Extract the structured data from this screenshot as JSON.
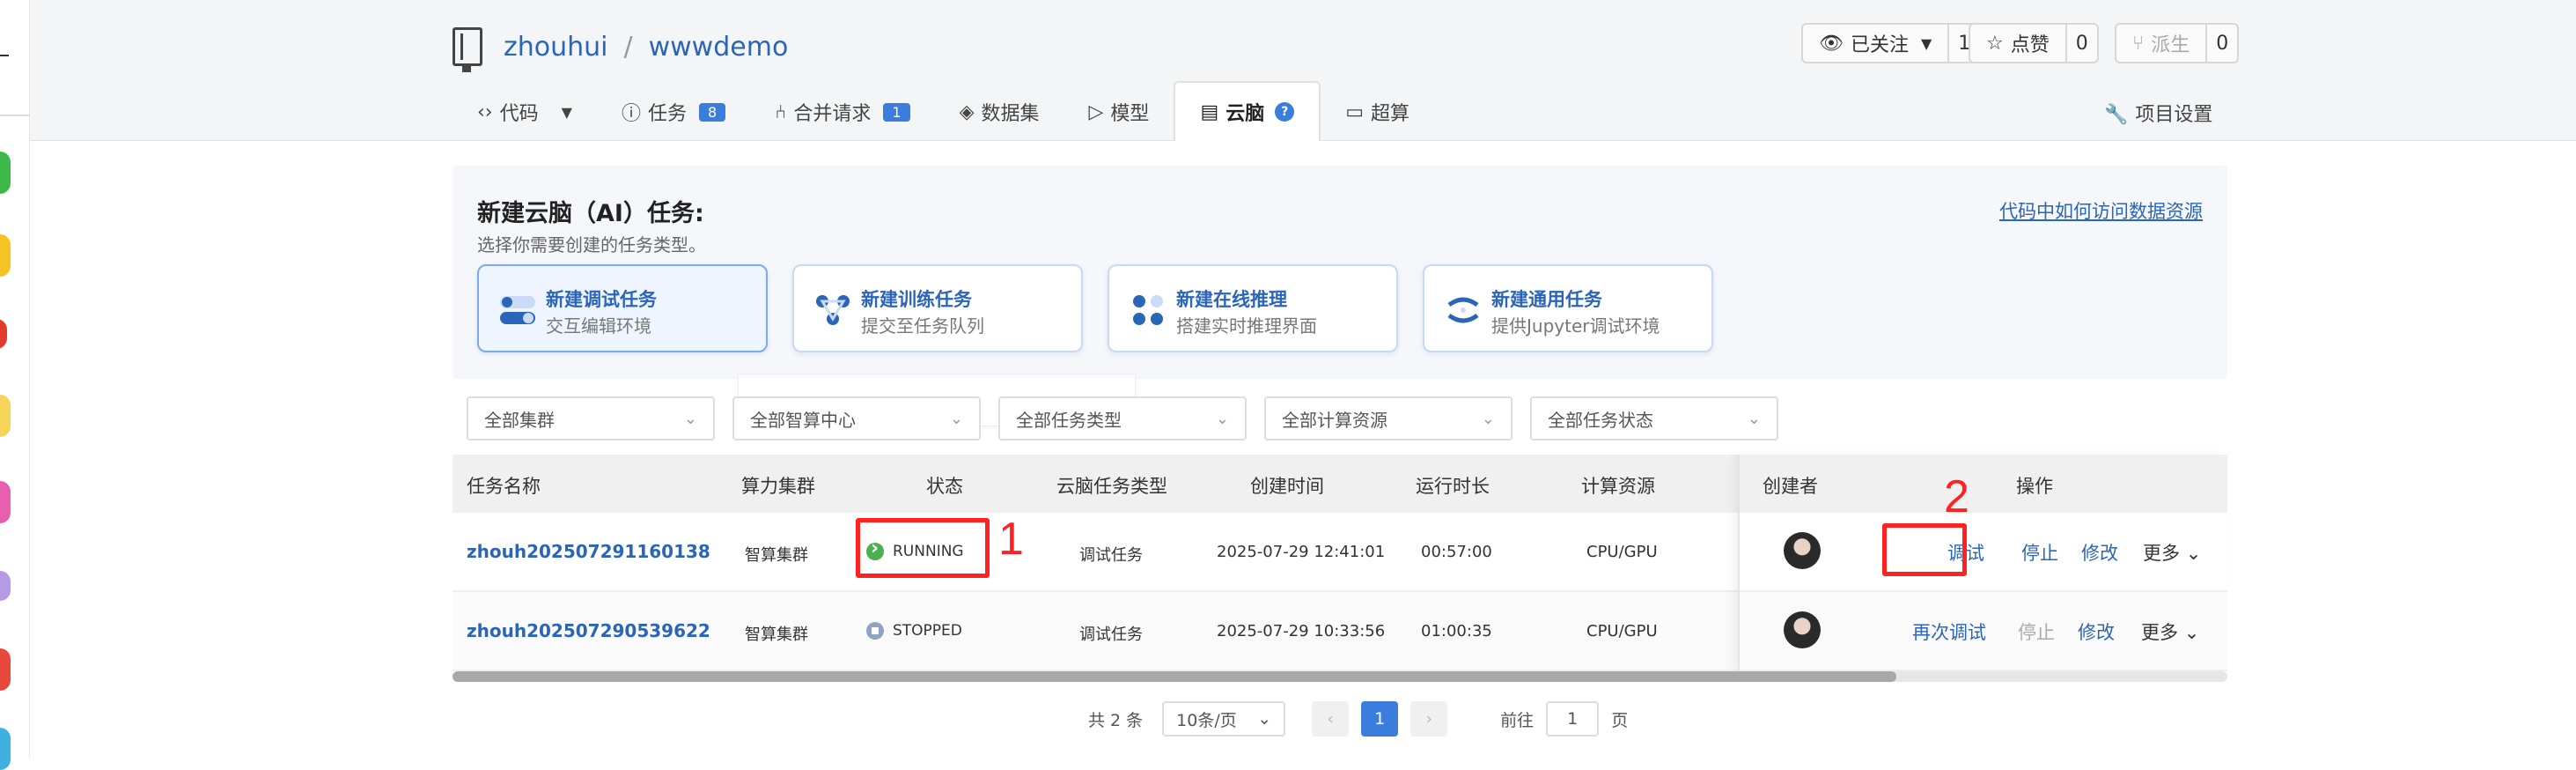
{
  "repo": {
    "owner": "zhouhui",
    "sep": "/",
    "name": "wwwdemo"
  },
  "header_buttons": {
    "watch": {
      "label": "已关注",
      "count": "1"
    },
    "star": {
      "label": "点赞",
      "count": "0"
    },
    "fork": {
      "label": "派生",
      "count": "0"
    }
  },
  "tabs": [
    {
      "label": "代码"
    },
    {
      "label": "任务",
      "badge": "8"
    },
    {
      "label": "合并请求",
      "badge": "1"
    },
    {
      "label": "数据集"
    },
    {
      "label": "模型"
    },
    {
      "label": "云脑",
      "qm": "?"
    },
    {
      "label": "超算"
    }
  ],
  "settings_label": "项目设置",
  "new_task": {
    "title": "新建云脑（AI）任务:",
    "subtitle": "选择你需要创建的任务类型。",
    "help_link": "代码中如何访问数据资源",
    "cards": [
      {
        "title": "新建调试任务",
        "desc": "交互编辑环境"
      },
      {
        "title": "新建训练任务",
        "desc": "提交至任务队列"
      },
      {
        "title": "新建在线推理",
        "desc": "搭建实时推理界面"
      },
      {
        "title": "新建通用任务",
        "desc": "提供Jupyter调试环境"
      }
    ]
  },
  "filters": [
    "全部集群",
    "全部智算中心",
    "全部任务类型",
    "全部计算资源",
    "全部任务状态"
  ],
  "table": {
    "headers": [
      "任务名称",
      "算力集群",
      "状态",
      "云脑任务类型",
      "创建时间",
      "运行时长",
      "计算资源",
      "创建者",
      "操作"
    ],
    "rows": [
      {
        "name": "zhouh202507291160138",
        "cluster": "智算集群",
        "status": "RUNNING",
        "type": "调试任务",
        "created": "2025-07-29 12:41:01",
        "duration": "00:57:00",
        "resource": "CPU/GPU",
        "actions": [
          "调试",
          "停止",
          "修改",
          "更多"
        ]
      },
      {
        "name": "zhouh202507290539622",
        "cluster": "智算集群",
        "status": "STOPPED",
        "type": "调试任务",
        "created": "2025-07-29 10:33:56",
        "duration": "01:00:35",
        "resource": "CPU/GPU",
        "actions": [
          "再次调试",
          "停止",
          "修改",
          "更多"
        ]
      }
    ]
  },
  "annotations": [
    "1",
    "2"
  ],
  "pager": {
    "total": "共 2 条",
    "page_size": "10条/页",
    "current": "1",
    "goto_label": "前往",
    "goto_value": "1",
    "page_unit": "页"
  },
  "colors": {
    "link": "#2b65b8",
    "accent": "#3b7ddd",
    "annotation": "#ff2222",
    "running": "#4caf50"
  }
}
